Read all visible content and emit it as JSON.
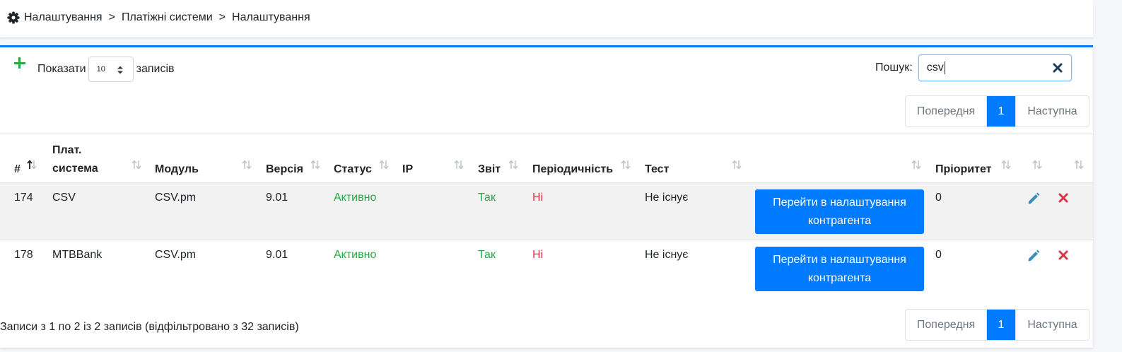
{
  "breadcrumb": {
    "items": [
      "Налаштування",
      "Платіжні системи",
      "Налаштування"
    ],
    "separator": ">"
  },
  "controls": {
    "show_label": "Показати",
    "page_length": "10",
    "entries_label": "записів",
    "search_label": "Пошук:",
    "search_value": "csv"
  },
  "pagination": {
    "previous": "Попередня",
    "current": "1",
    "next": "Наступна"
  },
  "table": {
    "headers": [
      "#",
      "Плат. система",
      "Модуль",
      "Версія",
      "Статус",
      "IP",
      "Звіт",
      "Періодичність",
      "Тест",
      "",
      "Пріоритет",
      "",
      ""
    ],
    "rows": [
      {
        "id": "174",
        "system": "CSV",
        "module": "CSV.pm",
        "version": "9.01",
        "status": "Активно",
        "ip": "",
        "report": "Так",
        "periodicity": "Ні",
        "test": "Не існує",
        "action": "Перейти в налаштування контрагента",
        "priority": "0"
      },
      {
        "id": "178",
        "system": "MTBBank",
        "module": "CSV.pm",
        "version": "9.01",
        "status": "Активно",
        "ip": "",
        "report": "Так",
        "periodicity": "Ні",
        "test": "Не існує",
        "action": "Перейти в налаштування контрагента",
        "priority": "0"
      }
    ]
  },
  "info": "Записи з 1 по 2 із 2 записів (відфільтровано з 32 записів)",
  "colors": {
    "primary": "#007bff",
    "success": "#28a745",
    "danger": "#dc3545",
    "border": "#dee2e6"
  }
}
